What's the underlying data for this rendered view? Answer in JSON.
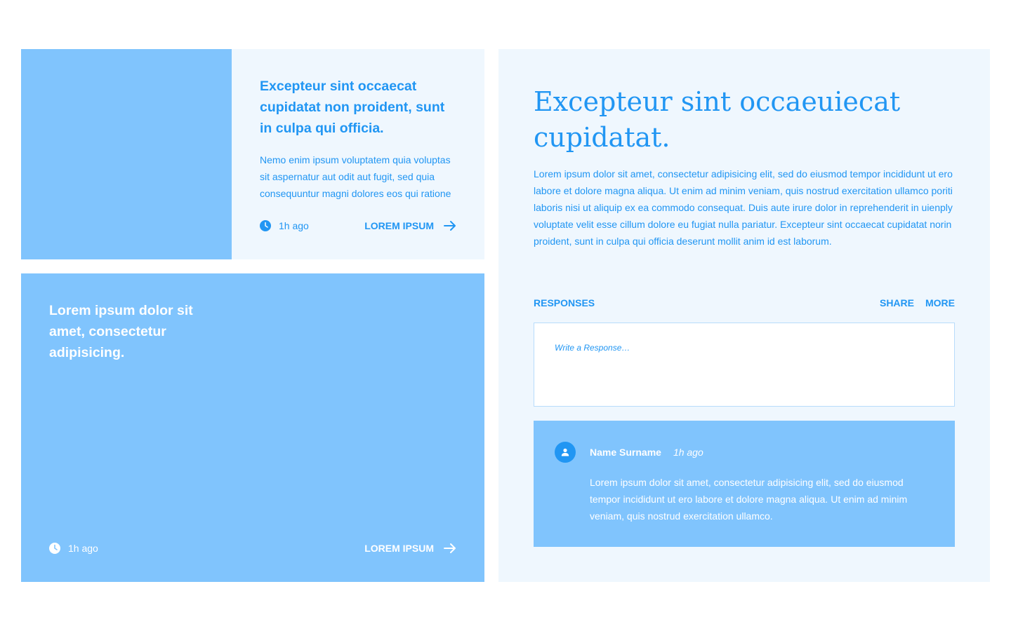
{
  "colors": {
    "accent": "#2196f3",
    "tile_blue": "#80c4fd",
    "panel_bg": "#eff7fe",
    "white": "#ffffff"
  },
  "card_one": {
    "title": "Excepteur sint occaecat cupidatat non proident, sunt in culpa qui officia.",
    "excerpt": "Nemo enim ipsum voluptatem quia voluptas sit aspernatur aut odit aut fugit, sed quia consequuntur magni dolores eos qui ratione",
    "time": "1h ago",
    "cta_label": "LOREM IPSUM",
    "clock_icon": "clock-icon",
    "arrow_icon": "arrow-right-icon"
  },
  "card_two": {
    "title": "Lorem ipsum dolor sit amet, consectetur adipisicing.",
    "time": "1h ago",
    "cta_label": "LOREM IPSUM",
    "clock_icon": "clock-icon",
    "arrow_icon": "arrow-right-icon"
  },
  "article": {
    "heading": "Excepteur sint occaeuiecat cupidatat.",
    "body": "Lorem ipsum dolor sit amet, consectetur adipisicing elit, sed do eiusmod tempor incididunt ut ero labore et dolore magna aliqua. Ut enim ad minim veniam, quis nostrud exercitation ullamco poriti laboris nisi ut aliquip ex ea commodo consequat. Duis aute irure dolor in reprehenderit in uienply voluptate velit esse cillum dolore eu fugiat nulla pariatur. Excepteur sint occaecat cupidatat norin proident, sunt in culpa qui officia deserunt mollit anim id est laborum.",
    "responses_label": "RESPONSES",
    "share_label": "SHARE",
    "more_label": "MORE",
    "response_placeholder": "Write a Response…",
    "response_value": ""
  },
  "comment": {
    "avatar_icon": "user-icon",
    "name": "Name Surname",
    "time": "1h ago",
    "text": "Lorem ipsum dolor sit amet, consectetur adipisicing elit, sed do eiusmod tempor incididunt ut ero labore et dolore magna aliqua. Ut enim ad minim veniam, quis nostrud exercitation ullamco."
  }
}
